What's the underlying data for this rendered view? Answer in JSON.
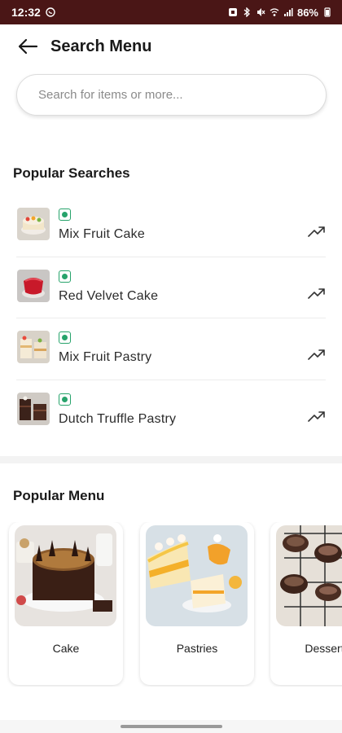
{
  "status_bar": {
    "time": "12:32",
    "battery": "86%",
    "icons": [
      "whatsapp-icon",
      "alarm-icon",
      "bluetooth-icon",
      "mute-icon",
      "wifi-icon",
      "signal-icon",
      "battery-icon"
    ]
  },
  "header": {
    "title": "Search Menu",
    "back_icon": "arrow-left-icon"
  },
  "search": {
    "placeholder": "Search for items or more..."
  },
  "popular_searches": {
    "title": "Popular Searches",
    "items": [
      {
        "name": "Mix Fruit Cake",
        "badge": "veg",
        "trend_icon": "trending-up-icon"
      },
      {
        "name": "Red Velvet Cake",
        "badge": "veg",
        "trend_icon": "trending-up-icon"
      },
      {
        "name": "Mix Fruit Pastry",
        "badge": "veg",
        "trend_icon": "trending-up-icon"
      },
      {
        "name": "Dutch Truffle Pastry",
        "badge": "veg",
        "trend_icon": "trending-up-icon"
      }
    ]
  },
  "popular_menu": {
    "title": "Popular Menu",
    "items": [
      {
        "label": "Cake"
      },
      {
        "label": "Pastries"
      },
      {
        "label": "Desserts"
      }
    ]
  },
  "colors": {
    "status_bar": "#4a1616",
    "veg_green": "#27a36b",
    "divider": "#f3f3f3"
  }
}
